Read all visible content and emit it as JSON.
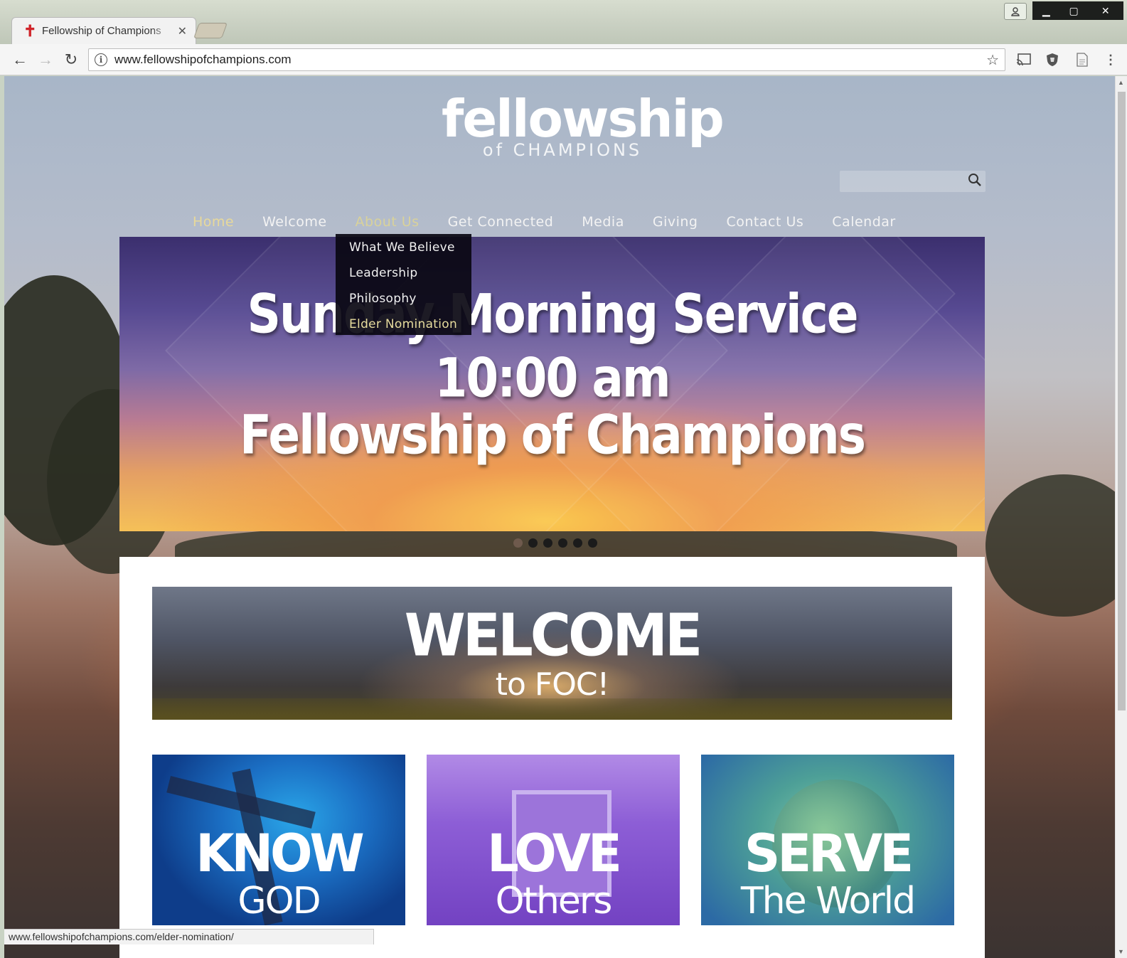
{
  "browser": {
    "tab_title": "Fellowship of Champions",
    "tab_close": "✕",
    "url": "www.fellowshipofchampions.com",
    "status_url": "www.fellowshipofchampions.com/elder-nomination/"
  },
  "site": {
    "logo_main": "fellowship",
    "logo_sub": "of CHAMPIONS",
    "nav": [
      {
        "label": "Home"
      },
      {
        "label": "Welcome"
      },
      {
        "label": "About Us"
      },
      {
        "label": "Get Connected"
      },
      {
        "label": "Media"
      },
      {
        "label": "Giving"
      },
      {
        "label": "Contact Us"
      },
      {
        "label": "Calendar"
      }
    ],
    "about_dropdown": [
      {
        "label": "What We Believe"
      },
      {
        "label": "Leadership"
      },
      {
        "label": "Philosophy"
      },
      {
        "label": "Elder Nomination"
      }
    ],
    "slide": {
      "line1": "Sunday Morning Service",
      "line2": "10:00 am",
      "line3": "Fellowship of Champions"
    },
    "slider_dots": 6,
    "welcome": {
      "big": "WELCOME",
      "small": "to FOC!"
    },
    "tiles": [
      {
        "t1": "KNOW",
        "t2": "GOD"
      },
      {
        "t1": "LOVE",
        "t2": "Others"
      },
      {
        "t1": "SERVE",
        "t2": "The World"
      }
    ]
  }
}
